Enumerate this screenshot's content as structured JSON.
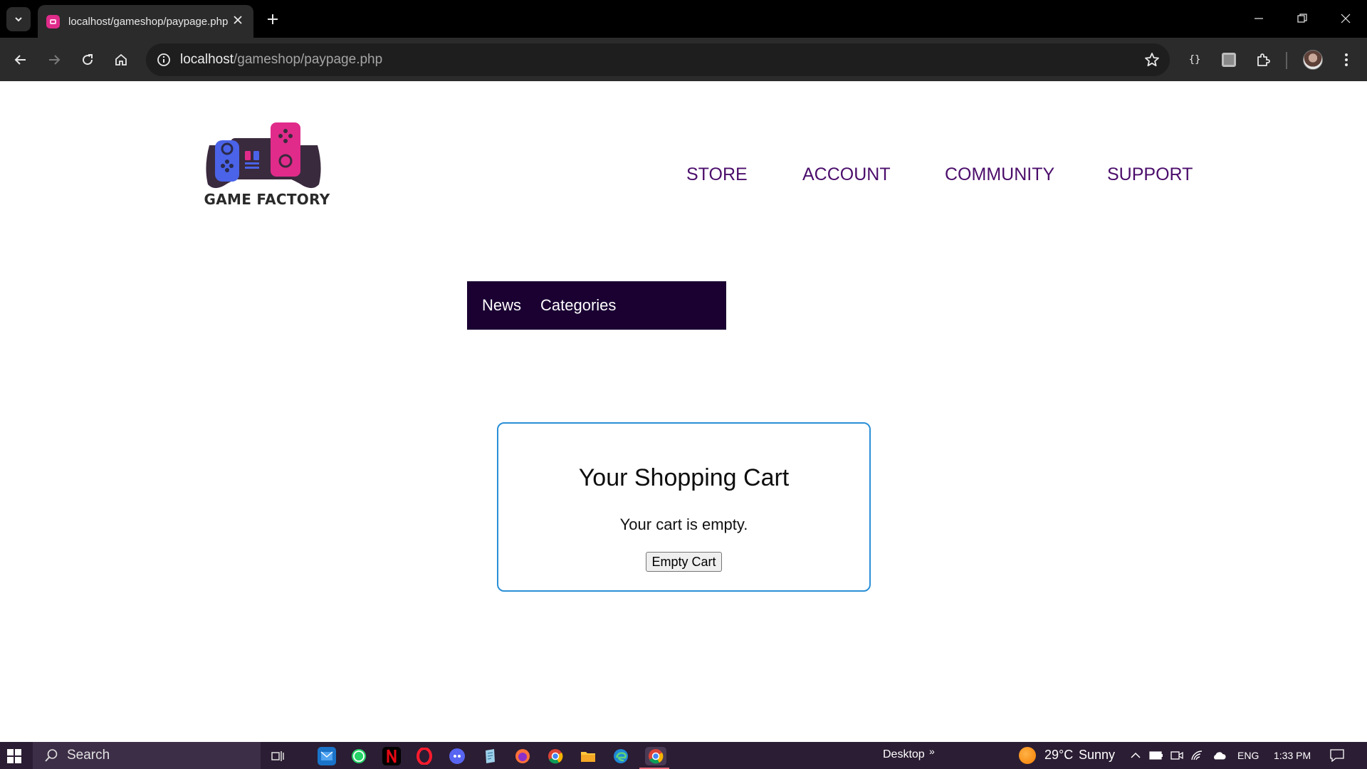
{
  "browser": {
    "tab": {
      "title": "localhost/gameshop/paypage.php"
    },
    "address": {
      "host": "localhost",
      "path": "/gameshop/paypage.php"
    },
    "ext_label": "{}"
  },
  "site": {
    "logo_text": "GAME FACTORY",
    "nav": {
      "store": "STORE",
      "account": "ACCOUNT",
      "community": "COMMUNITY",
      "support": "SUPPORT"
    },
    "subnav": {
      "news": "News",
      "categories": "Categories"
    },
    "cart": {
      "title": "Your Shopping Cart",
      "message": "Your cart is empty.",
      "button": "Empty Cart"
    }
  },
  "taskbar": {
    "search_label": "Search",
    "desktop_label": "Desktop",
    "weather_temp": "29°C",
    "weather_cond": "Sunny",
    "language": "ENG",
    "time": "1:33 PM"
  },
  "colors": {
    "nav_text": "#4b0d6b",
    "subnav_bg": "#1a0132",
    "cart_border": "#2a8fd6",
    "logo_pink": "#e02b8a",
    "logo_blue": "#4a63e8",
    "logo_dark": "#3a2a3e"
  }
}
